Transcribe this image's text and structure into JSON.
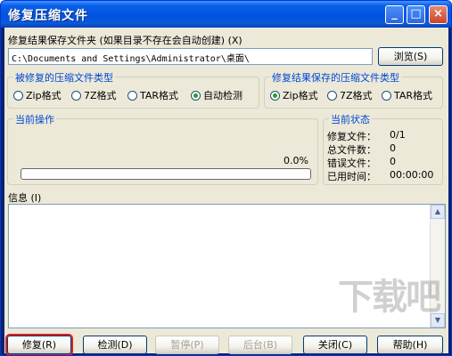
{
  "window": {
    "title": "修复压缩文件",
    "minimize": "_",
    "maximize": "□",
    "close": "×"
  },
  "output_folder": {
    "label": "修复结果保存文件夹 (如果目录不存在会自动创建) (X)",
    "path": "C:\\Documents and Settings\\Administrator\\桌面\\",
    "browse_label": "浏览(S)"
  },
  "source_type": {
    "title": "被修复的压缩文件类型",
    "options": [
      {
        "label": "Zip格式",
        "selected": false
      },
      {
        "label": "7Z格式",
        "selected": false
      },
      {
        "label": "TAR格式",
        "selected": false
      },
      {
        "label": "自动检测",
        "selected": true
      }
    ]
  },
  "result_type": {
    "title": "修复结果保存的压缩文件类型",
    "options": [
      {
        "label": "Zip格式",
        "selected": true
      },
      {
        "label": "7Z格式",
        "selected": false
      },
      {
        "label": "TAR格式",
        "selected": false
      }
    ]
  },
  "current_operation": {
    "title": "当前操作",
    "progress_text": "0.0%",
    "progress_value": 0.0
  },
  "current_status": {
    "title": "当前状态",
    "rows": [
      {
        "label": "修复文件：",
        "value": "0/1"
      },
      {
        "label": "总文件数：",
        "value": "0"
      },
      {
        "label": "错误文件：",
        "value": "0"
      },
      {
        "label": "已用时间：",
        "value": "00:00:00"
      }
    ]
  },
  "info": {
    "label": "信息 (I)"
  },
  "buttons": {
    "repair": "修复(R)",
    "detect": "检测(D)",
    "pause": "暂停(P)",
    "background": "后台(B)",
    "close": "关闭(C)",
    "help": "帮助(H)"
  },
  "watermark": "下载吧"
}
